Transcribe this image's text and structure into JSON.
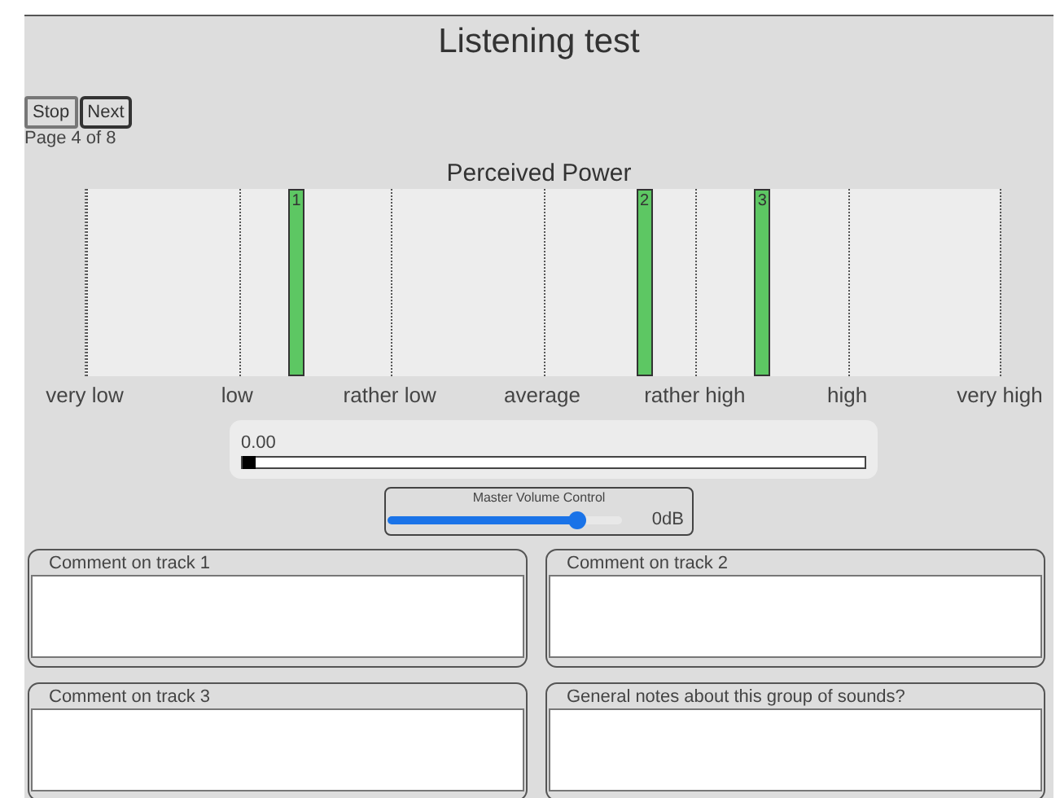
{
  "title": "Listening test",
  "buttons": [
    {
      "label": "Stop"
    },
    {
      "label": "Next"
    }
  ],
  "page_indicator": "Page 4 of 8",
  "scale": {
    "title": "Perceived Power",
    "labels": [
      "very low",
      "low",
      "rather low",
      "average",
      "rather high",
      "high",
      "very high"
    ],
    "markers": [
      {
        "label": "1",
        "level": 0.23
      },
      {
        "label": "2",
        "level": 0.611
      },
      {
        "label": "3",
        "level": 0.74
      }
    ]
  },
  "playback": {
    "time": "0.00",
    "level": 0
  },
  "master_volume": {
    "label": "Master Volume Control",
    "level": 0.81,
    "reading": "0dB"
  },
  "comments": [
    {
      "label": "Comment on track 1"
    },
    {
      "label": "Comment on track 2"
    },
    {
      "label": "Comment on track 3"
    },
    {
      "label": "General notes about this group of sounds?"
    }
  ]
}
